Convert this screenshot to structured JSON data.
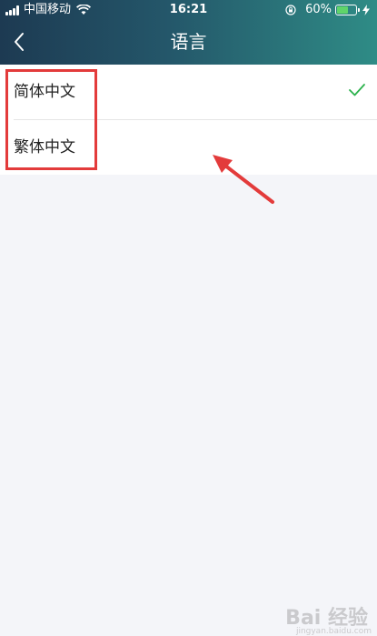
{
  "status_bar": {
    "carrier": "中国移动",
    "time": "16:21",
    "battery_percent": "60%",
    "battery_level": 0.6
  },
  "nav": {
    "title": "语言",
    "back_icon": "chevron-left-icon"
  },
  "languages": [
    {
      "label": "简体中文",
      "selected": true
    },
    {
      "label": "繁体中文",
      "selected": false
    }
  ],
  "colors": {
    "accent_check": "#2bb24c",
    "annotation": "#e33b3b",
    "header_start": "#1d3a52",
    "header_end": "#2f8c86"
  },
  "watermark": {
    "text": "Bai 经验",
    "sub": "jingyan.baidu.com"
  }
}
